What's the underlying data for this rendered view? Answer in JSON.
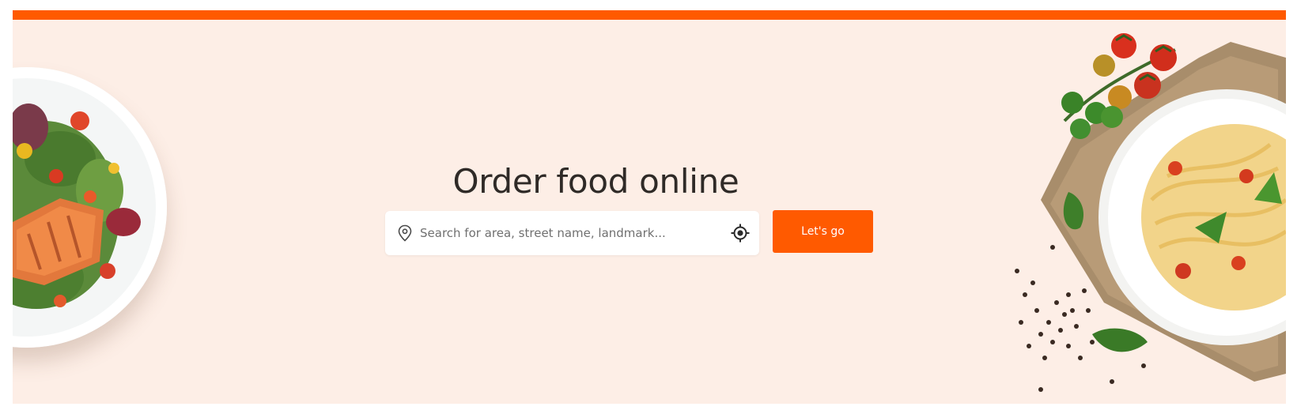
{
  "hero": {
    "title": "Order food online"
  },
  "search": {
    "placeholder": "Search for area, street name, landmark...",
    "value": "",
    "leading_icon": "map-pin-icon",
    "trailing_icon": "locate-me-icon"
  },
  "cta": {
    "label": "Let's go"
  },
  "colors": {
    "brand": "#ff5a00",
    "hero_background": "#fdeee6",
    "title_text": "#2f2a27"
  },
  "images": {
    "left": "salad-plate-image",
    "right": "pasta-plate-image"
  }
}
